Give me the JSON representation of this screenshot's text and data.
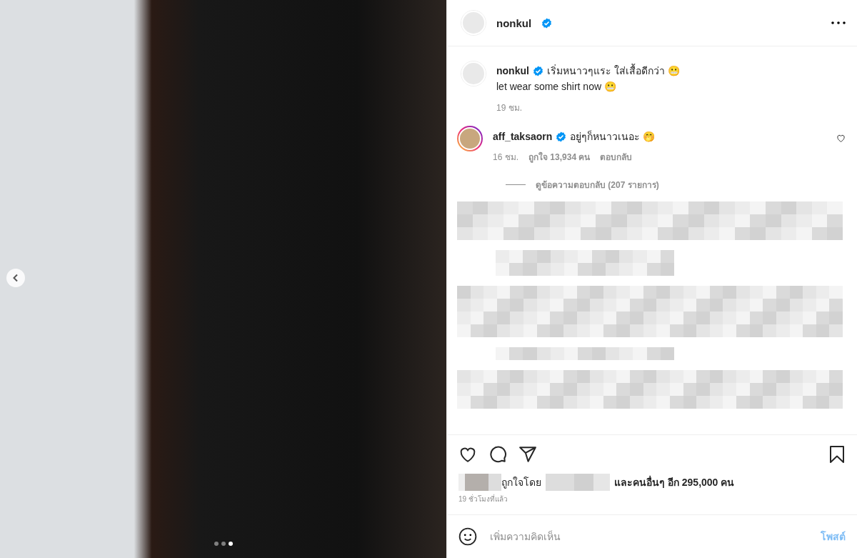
{
  "photo": {
    "carousel_dots": [
      {
        "selected": false
      },
      {
        "selected": false
      },
      {
        "selected": true
      }
    ]
  },
  "header": {
    "username": "nonkul",
    "verified": true
  },
  "caption": {
    "username": "nonkul",
    "verified": true,
    "text": "เริ่มหนาวๆแระ ใส่เสื้อดีกว่า 😬",
    "second_line": "let wear some shirt now 😬",
    "time": "19 ชม."
  },
  "comments": [
    {
      "username": "aff_taksaorn",
      "verified": true,
      "text": "อยู่ๆก็หนาวเนอะ 🤭",
      "time": "16 ชม.",
      "likes": "ถูกใจ 13,934 คน",
      "reply": "ตอบกลับ",
      "liked": false,
      "view_replies": "ดูข้อความตอบกลับ (207 รายการ)"
    }
  ],
  "actions": {
    "liked": false,
    "saved": false
  },
  "likes_line": {
    "prefix": "ถูกใจโดย",
    "suffix": "และคนอื่นๆ อีก 295,000 คน"
  },
  "post_time": "19 ชั่วโมงที่แล้ว",
  "comment_box": {
    "placeholder": "เพิ่มความคิดเห็น",
    "post_button": "โพสต์",
    "post_disabled": true
  }
}
